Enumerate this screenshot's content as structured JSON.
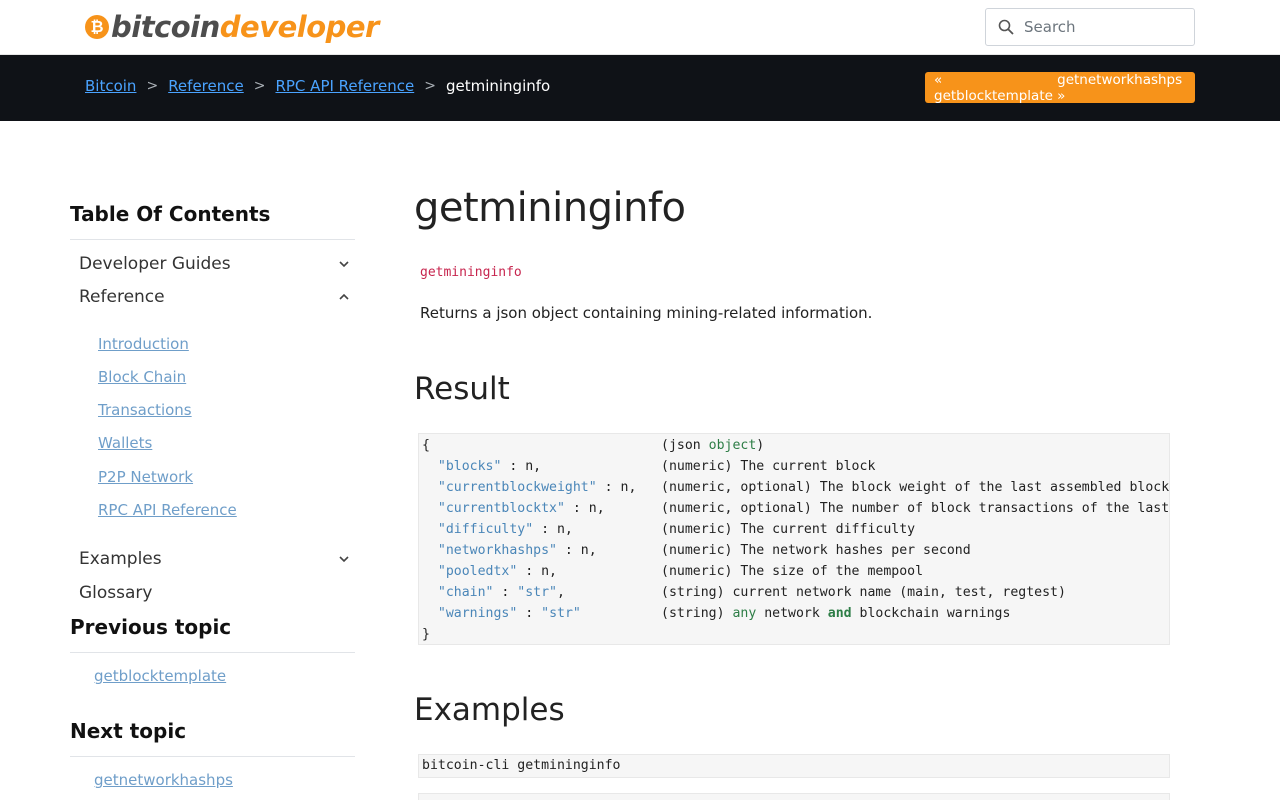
{
  "header": {
    "logo_part1": "bitcoin",
    "logo_part2": "developer",
    "logo_coin_symbol": "₿",
    "search_placeholder": "Search"
  },
  "breadcrumb": {
    "items": [
      "Bitcoin",
      "Reference",
      "RPC API Reference"
    ],
    "separator": ">",
    "current": "getmininginfo"
  },
  "pager": {
    "prev": "« getblocktemplate",
    "next": "getnetworkhashps »"
  },
  "sidebar": {
    "toc_title": "Table Of Contents",
    "sections": [
      {
        "label": "Developer Guides",
        "expanded": false
      },
      {
        "label": "Reference",
        "expanded": true
      },
      {
        "label": "Examples",
        "expanded": false
      },
      {
        "label": "Glossary"
      }
    ],
    "reference_links": [
      "Introduction",
      "Block Chain",
      "Transactions",
      "Wallets",
      "P2P Network",
      "RPC API Reference"
    ],
    "previous_title": "Previous topic",
    "previous_link": "getblocktemplate",
    "next_title": "Next topic",
    "next_link": "getnetworkhashps"
  },
  "main": {
    "title": "getmininginfo",
    "syntax": "getmininginfo",
    "description": "Returns a json object containing mining-related information.",
    "result_heading": "Result",
    "result_lines": [
      {
        "key": "{",
        "type": "(json ",
        "type_kw": "object",
        "type_end": ")",
        "text": ""
      },
      {
        "key_str": "\"blocks\"",
        "key_rest": " : n,",
        "type": "(numeric)",
        "text": " The current block"
      },
      {
        "key_str": "\"currentblockweight\"",
        "key_rest": " : n,",
        "type": "(numeric, optional)",
        "text": " The block weight of the last assembled block (only present if a block was ever assembled)"
      },
      {
        "key_str": "\"currentblocktx\"",
        "key_rest": " : n,",
        "type": "(numeric, optional)",
        "text": " The number of block transactions of the last assembled block (only present if a block was ever assembled)"
      },
      {
        "key_str": "\"difficulty\"",
        "key_rest": " : n,",
        "type": "(numeric)",
        "text": " The current difficulty"
      },
      {
        "key_str": "\"networkhashps\"",
        "key_rest": " : n,",
        "type": "(numeric)",
        "text": " The network hashes per second"
      },
      {
        "key_str": "\"pooledtx\"",
        "key_rest": " : n,",
        "type": "(numeric)",
        "text": " The size of the mempool"
      },
      {
        "key_str": "\"chain\"",
        "key_rest": " : ",
        "val_str": "\"str\"",
        "val_rest": ",",
        "type": "(string)",
        "text": " current network name (main, test, regtest)"
      },
      {
        "key_str": "\"warnings\"",
        "key_rest": " : ",
        "val_str": "\"str\"",
        "val_rest": "",
        "type": "(string)",
        "text_kw1": " any",
        "text_mid": " network ",
        "text_kw2": "and",
        "text_end": " blockchain warnings"
      },
      {
        "key": "}",
        "text": ""
      }
    ],
    "examples_heading": "Examples",
    "example_cmd": "bitcoin-cli getmininginfo"
  }
}
